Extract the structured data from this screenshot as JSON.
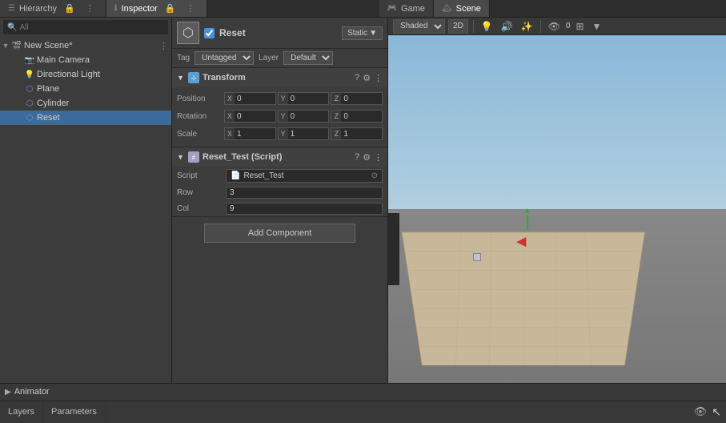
{
  "hierarchy": {
    "title": "Hierarchy",
    "search_placeholder": "All",
    "scene_name": "New Scene*",
    "items": [
      {
        "id": "main-camera",
        "label": "Main Camera",
        "indent": 1,
        "icon": "📷",
        "selected": false
      },
      {
        "id": "directional-light",
        "label": "Directional Light",
        "indent": 1,
        "icon": "💡",
        "selected": false
      },
      {
        "id": "plane",
        "label": "Plane",
        "indent": 1,
        "icon": "▭",
        "selected": false
      },
      {
        "id": "cylinder",
        "label": "Cylinder",
        "indent": 1,
        "icon": "⬡",
        "selected": false
      },
      {
        "id": "reset",
        "label": "Reset",
        "indent": 1,
        "icon": "⬡",
        "selected": true
      }
    ]
  },
  "inspector": {
    "title": "Inspector",
    "object_name": "Reset",
    "static_label": "Static",
    "static_arrow": "▼",
    "tag_label": "Tag",
    "tag_value": "Untagged",
    "layer_label": "Layer",
    "layer_value": "Default",
    "transform": {
      "title": "Transform",
      "position_label": "Position",
      "rotation_label": "Rotation",
      "scale_label": "Scale",
      "position": {
        "x": "0",
        "y": "0",
        "z": "0"
      },
      "rotation": {
        "x": "0",
        "y": "0",
        "z": "0"
      },
      "scale": {
        "x": "1",
        "y": "1",
        "z": "1"
      }
    },
    "script": {
      "title": "Reset_Test (Script)",
      "script_label": "Script",
      "script_file": "Reset_Test",
      "row_label": "Row",
      "row_value": "3",
      "col_label": "Col",
      "col_value": "9"
    },
    "add_component_label": "Add Component"
  },
  "viewport": {
    "game_tab": "Game",
    "scene_tab": "Scene",
    "shading_mode": "Shaded",
    "dimension": "2D",
    "toolbar_icons": [
      "👁",
      "🔊",
      "📷",
      "⚙"
    ]
  },
  "animator": {
    "title": "Animator",
    "tabs": [
      {
        "id": "layers",
        "label": "Layers",
        "active": false
      },
      {
        "id": "parameters",
        "label": "Parameters",
        "active": false
      }
    ],
    "eye_icon": "👁",
    "cursor_icon": "↖"
  }
}
